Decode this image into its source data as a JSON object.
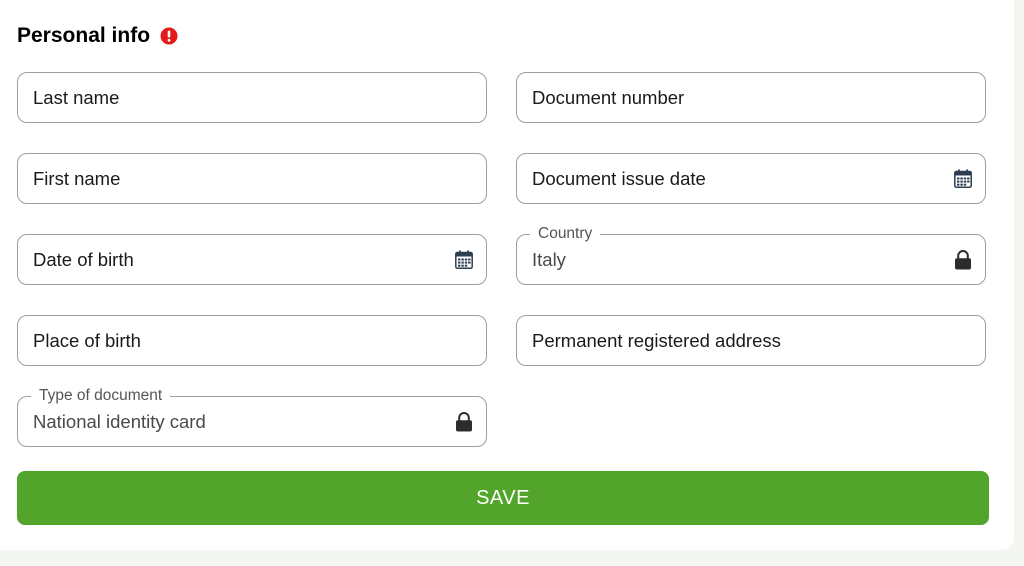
{
  "section": {
    "title": "Personal info",
    "alert_icon": "exclamation-circle-icon",
    "alert_color": "#e21b1b"
  },
  "left_fields": {
    "last_name": {
      "placeholder": "Last name"
    },
    "first_name": {
      "placeholder": "First name"
    },
    "date_of_birth": {
      "placeholder": "Date of birth",
      "icon": "calendar-icon"
    },
    "place_of_birth": {
      "placeholder": "Place of birth"
    },
    "type_of_document": {
      "label": "Type of document",
      "value": "National identity card",
      "icon": "lock-icon",
      "locked": true
    }
  },
  "right_fields": {
    "document_number": {
      "placeholder": "Document number"
    },
    "document_issue_date": {
      "placeholder": "Document issue date",
      "icon": "calendar-icon"
    },
    "country": {
      "label": "Country",
      "value": "Italy",
      "icon": "lock-icon",
      "locked": true
    },
    "permanent_address": {
      "placeholder": "Permanent registered address"
    }
  },
  "save_button": {
    "label": "SAVE",
    "color": "#52a52a"
  },
  "colors": {
    "border": "#9a9fa8",
    "icon": "#2c3e50",
    "background": "#f3f6f1"
  }
}
